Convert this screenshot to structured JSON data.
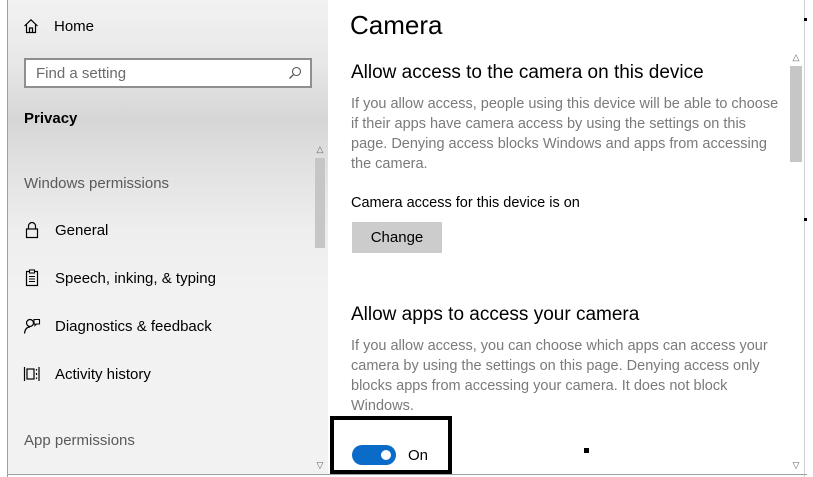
{
  "sidebar": {
    "home_label": "Home",
    "search": {
      "placeholder": "Find a setting",
      "value": ""
    },
    "category": "Privacy",
    "sections": [
      {
        "header": "Windows permissions",
        "items": [
          {
            "label": "General",
            "icon": "lock-icon"
          },
          {
            "label": "Speech, inking, & typing",
            "icon": "clipboard-icon"
          },
          {
            "label": "Diagnostics & feedback",
            "icon": "person-feedback-icon"
          },
          {
            "label": "Activity history",
            "icon": "activity-history-icon"
          }
        ]
      },
      {
        "header": "App permissions",
        "items": []
      }
    ]
  },
  "main": {
    "title": "Camera",
    "device_section": {
      "title": "Allow access to the camera on this device",
      "description": "If you allow access, people using this device will be able to choose if their apps have camera access by using the settings on this page. Denying access blocks Windows and apps from accessing the camera.",
      "status": "Camera access for this device is on",
      "button_label": "Change"
    },
    "apps_section": {
      "title": "Allow apps to access your camera",
      "description": "If you allow access, you can choose which apps can access your camera by using the settings on this page. Denying access only blocks apps from accessing your camera. It does not block Windows.",
      "toggle_state": "On",
      "toggle_on": true
    }
  },
  "colors": {
    "accent": "#0a6bc9",
    "sidebar_bg": "#f2f2f2",
    "button_bg": "#cccccc",
    "description_text": "#7a7a7a"
  }
}
